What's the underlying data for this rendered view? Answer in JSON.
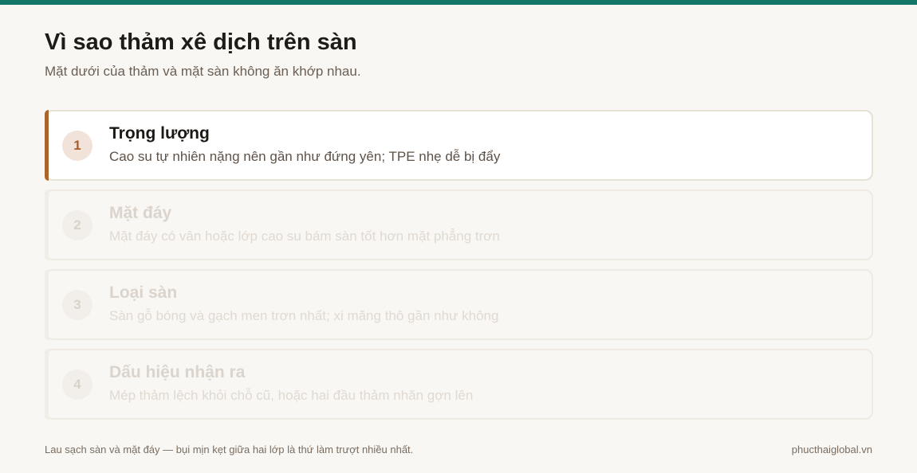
{
  "colors": {
    "top_bar": "#127668",
    "accent_active": "#a8662f",
    "background": "#f9f7f3"
  },
  "header": {
    "title": "Vì sao thảm xê dịch trên sàn",
    "subtitle": "Mặt dưới của thảm và mặt sàn không ăn khớp nhau."
  },
  "steps": [
    {
      "number": "1",
      "title": "Trọng lượng",
      "description": "Cao su tự nhiên nặng nên gần như đứng yên; TPE nhẹ dễ bị đẩy",
      "active": true
    },
    {
      "number": "2",
      "title": "Mặt đáy",
      "description": "Mặt đáy có vân hoặc lớp cao su bám sàn tốt hơn mặt phẳng trơn",
      "active": false
    },
    {
      "number": "3",
      "title": "Loại sàn",
      "description": "Sàn gỗ bóng và gạch men trơn nhất; xi măng thô gần như không",
      "active": false
    },
    {
      "number": "4",
      "title": "Dấu hiệu nhận ra",
      "description": "Mép thảm lệch khỏi chỗ cũ, hoặc hai đầu thảm nhăn gợn lên",
      "active": false
    }
  ],
  "footer": {
    "note": "Lau sạch sàn và mặt đáy — bụi mịn kẹt giữa hai lớp là thứ làm trượt nhiều nhất.",
    "site": "phucthaiglobal.vn"
  }
}
